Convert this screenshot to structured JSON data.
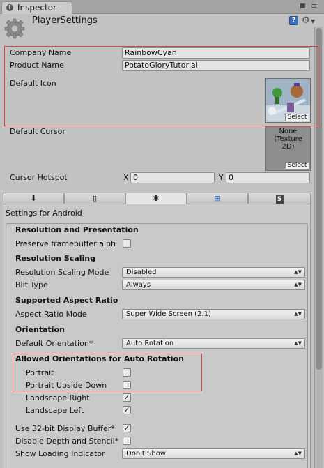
{
  "window": {
    "tab_label": "Inspector",
    "title": "PlayerSettings",
    "tab_icon": "inspector-icon",
    "lock_icon": "lock-icon",
    "menu_icon": "menu-icon"
  },
  "player": {
    "company_name_label": "Company Name",
    "company_name_value": "RainbowCyan",
    "product_name_label": "Product Name",
    "product_name_value": "PotatoGloryTutorial",
    "default_icon_label": "Default Icon",
    "icon_select": "Select",
    "default_cursor_label": "Default Cursor",
    "cursor_placeholder_line1": "None",
    "cursor_placeholder_line2": "(Texture",
    "cursor_placeholder_line3": "2D)",
    "cursor_select": "Select",
    "cursor_hotspot_label": "Cursor Hotspot",
    "hotspot_x_label": "X",
    "hotspot_x_value": "0",
    "hotspot_y_label": "Y",
    "hotspot_y_value": "0"
  },
  "platform_tabs": [
    {
      "icon": "download-icon",
      "glyph": "⬇"
    },
    {
      "icon": "phone-icon",
      "glyph": "▯"
    },
    {
      "icon": "android-icon",
      "glyph": "✱"
    },
    {
      "icon": "windows-icon",
      "glyph": "⊞"
    },
    {
      "icon": "html5-icon",
      "glyph": "5"
    }
  ],
  "android": {
    "settings_title": "Settings for Android",
    "resolution_header": "Resolution and Presentation",
    "preserve_framebuffer_label": "Preserve framebuffer alph",
    "preserve_framebuffer_checked": false,
    "resolution_scaling_header": "Resolution Scaling",
    "scaling_mode_label": "Resolution Scaling Mode",
    "scaling_mode_value": "Disabled",
    "blit_type_label": "Blit Type",
    "blit_type_value": "Always",
    "aspect_header": "Supported Aspect Ratio",
    "aspect_mode_label": "Aspect Ratio Mode",
    "aspect_mode_value": "Super Wide Screen (2.1)",
    "orientation_header": "Orientation",
    "default_orientation_label": "Default Orientation*",
    "default_orientation_value": "Auto Rotation",
    "allowed_header": "Allowed Orientations for Auto Rotation",
    "portrait_label": "Portrait",
    "portrait_checked": false,
    "portrait_upside_label": "Portrait Upside Down",
    "portrait_upside_checked": false,
    "landscape_right_label": "Landscape Right",
    "landscape_right_checked": true,
    "landscape_left_label": "Landscape Left",
    "landscape_left_checked": true,
    "display_buffer_label": "Use 32-bit Display Buffer*",
    "display_buffer_checked": true,
    "disable_depth_label": "Disable Depth and Stencil*",
    "disable_depth_checked": false,
    "loading_indicator_label": "Show Loading Indicator",
    "loading_indicator_value": "Don't Show"
  },
  "colors": {
    "highlight_border": "#e0403c",
    "panel_bg": "#c2c2c2"
  }
}
